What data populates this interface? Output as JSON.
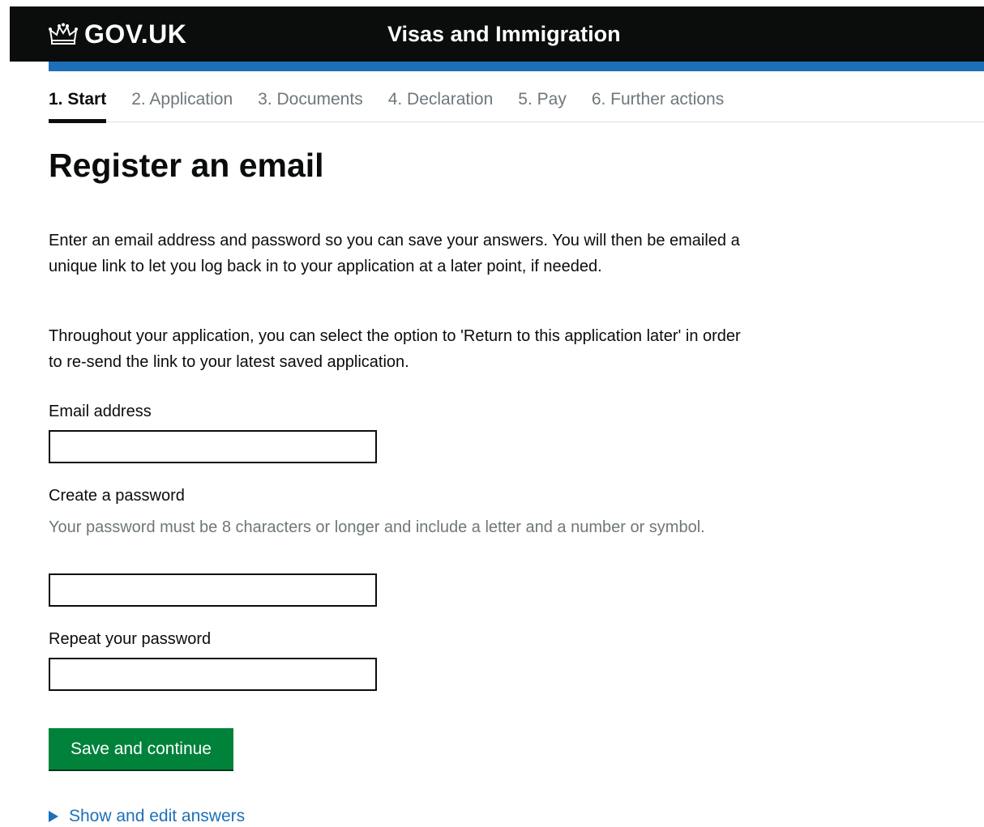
{
  "header": {
    "logo_text": "GOV.UK",
    "logo_icon": "crown-icon",
    "service_name": "Visas and Immigration"
  },
  "steps": [
    {
      "label": "1. Start",
      "active": true
    },
    {
      "label": "2. Application",
      "active": false
    },
    {
      "label": "3. Documents",
      "active": false
    },
    {
      "label": "4. Declaration",
      "active": false
    },
    {
      "label": "5. Pay",
      "active": false
    },
    {
      "label": "6. Further actions",
      "active": false
    }
  ],
  "main": {
    "title": "Register an email",
    "intro_1": "Enter an email address and password so you can save your answers. You will then be emailed a unique link to let you log back in to your application at a later point, if needed.",
    "intro_2": "Throughout your application, you can select the option to 'Return to this application later' in order to re-send the link to your latest saved application.",
    "email": {
      "label": "Email address",
      "value": ""
    },
    "password": {
      "label": "Create a password",
      "hint": "Your password must be 8 characters or longer and include a letter and a number or symbol.",
      "value": ""
    },
    "repeat_password": {
      "label": "Repeat your password",
      "value": ""
    },
    "submit_label": "Save and continue",
    "details_label": "Show and edit answers",
    "details_icon": "triangle-right-icon"
  },
  "colors": {
    "header_bg": "#0b0c0c",
    "header_bar": "#1d70b8",
    "button_green": "#00823b",
    "link_blue": "#1d70b8",
    "hint_grey": "#6f777b"
  }
}
